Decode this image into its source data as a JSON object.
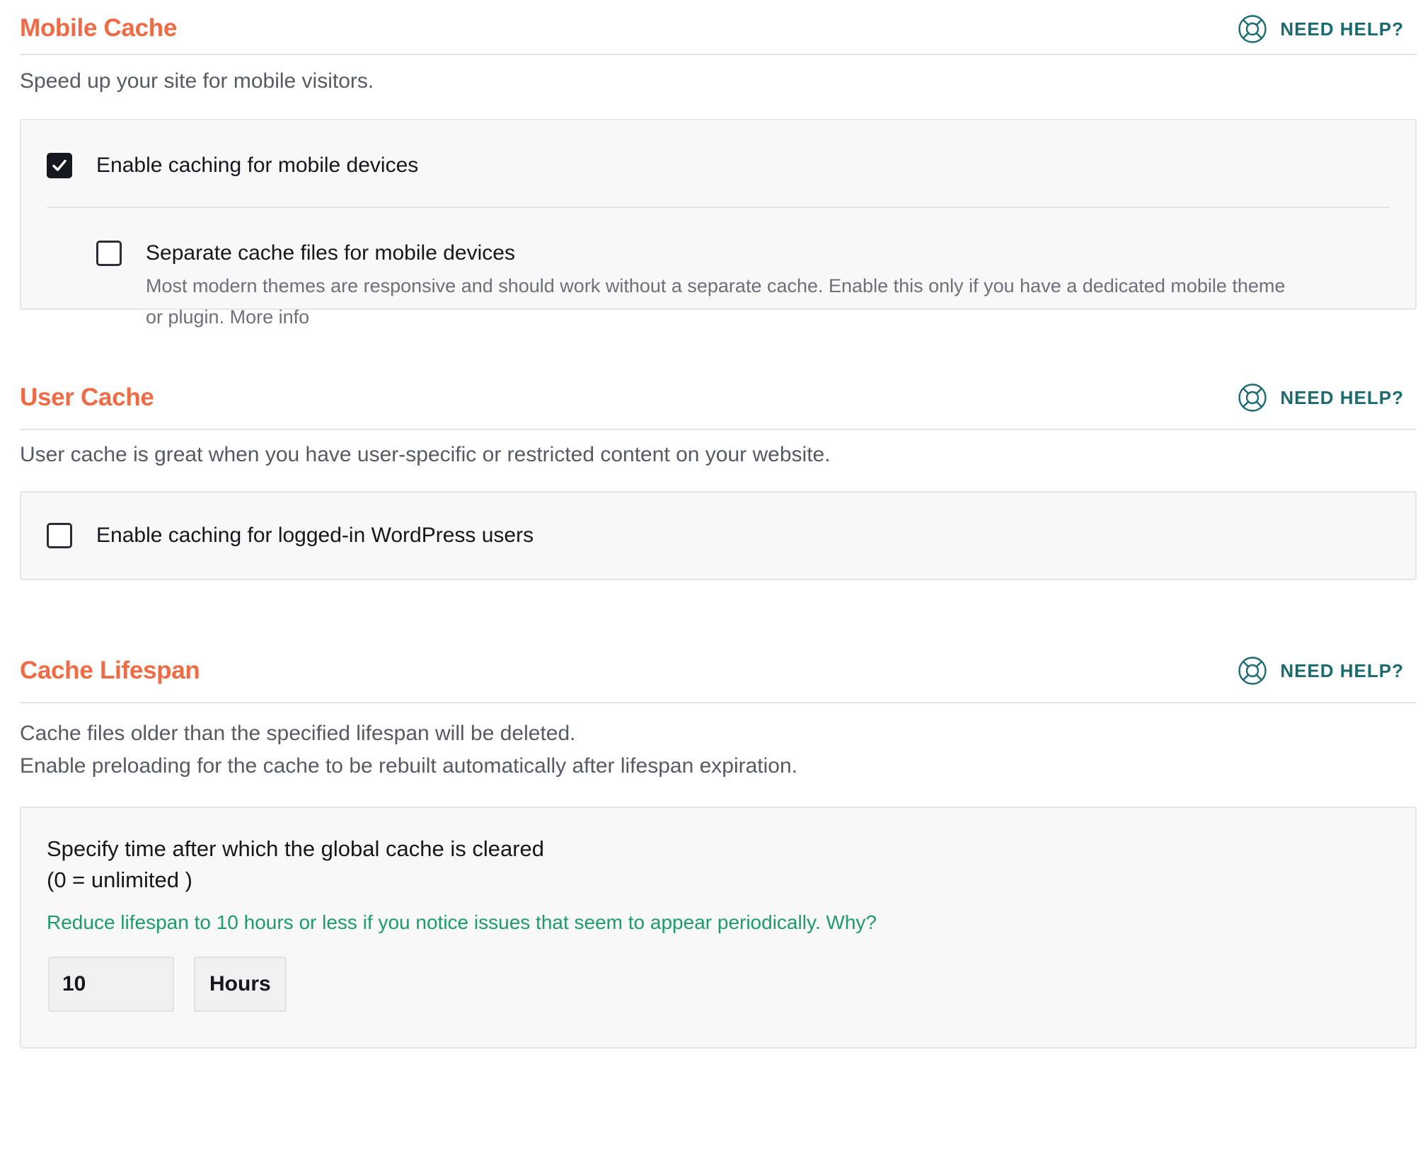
{
  "sections": {
    "mobile": {
      "title": "Mobile Cache",
      "help_label": "NEED HELP?",
      "description": "Speed up your site for mobile visitors.",
      "options": [
        {
          "label": "Enable caching for mobile devices",
          "checked": true
        },
        {
          "label": "Separate cache files for mobile devices",
          "checked": false,
          "help_text": "Most modern themes are responsive and should work without a separate cache. Enable this only if you have a dedicated mobile theme or plugin.",
          "more_info": "More info"
        }
      ]
    },
    "user": {
      "title": "User Cache",
      "help_label": "NEED HELP?",
      "description": "User cache is great when you have user-specific or restricted content on your website.",
      "options": [
        {
          "label": "Enable caching for logged-in WordPress users",
          "checked": false
        }
      ]
    },
    "lifespan": {
      "title": "Cache Lifespan",
      "help_label": "NEED HELP?",
      "description_line1": "Cache files older than the specified lifespan will be deleted.",
      "description_line2": "Enable preloading for the cache to be rebuilt automatically after lifespan expiration.",
      "field_label_line1": "Specify time after which the global cache is cleared",
      "field_label_line2": "(0 = unlimited )",
      "tip": "Reduce lifespan to 10 hours or less if you notice issues that seem to appear periodically.",
      "tip_link": "Why?",
      "value": "10",
      "unit": "Hours"
    }
  },
  "icons": {
    "help": "life-ring-icon",
    "check": "checkmark-icon"
  },
  "colors": {
    "section_title": "#ed6b45",
    "help_link": "#1a6a70",
    "tip": "#1e9b6b",
    "checkbox_checked": "#161820"
  }
}
